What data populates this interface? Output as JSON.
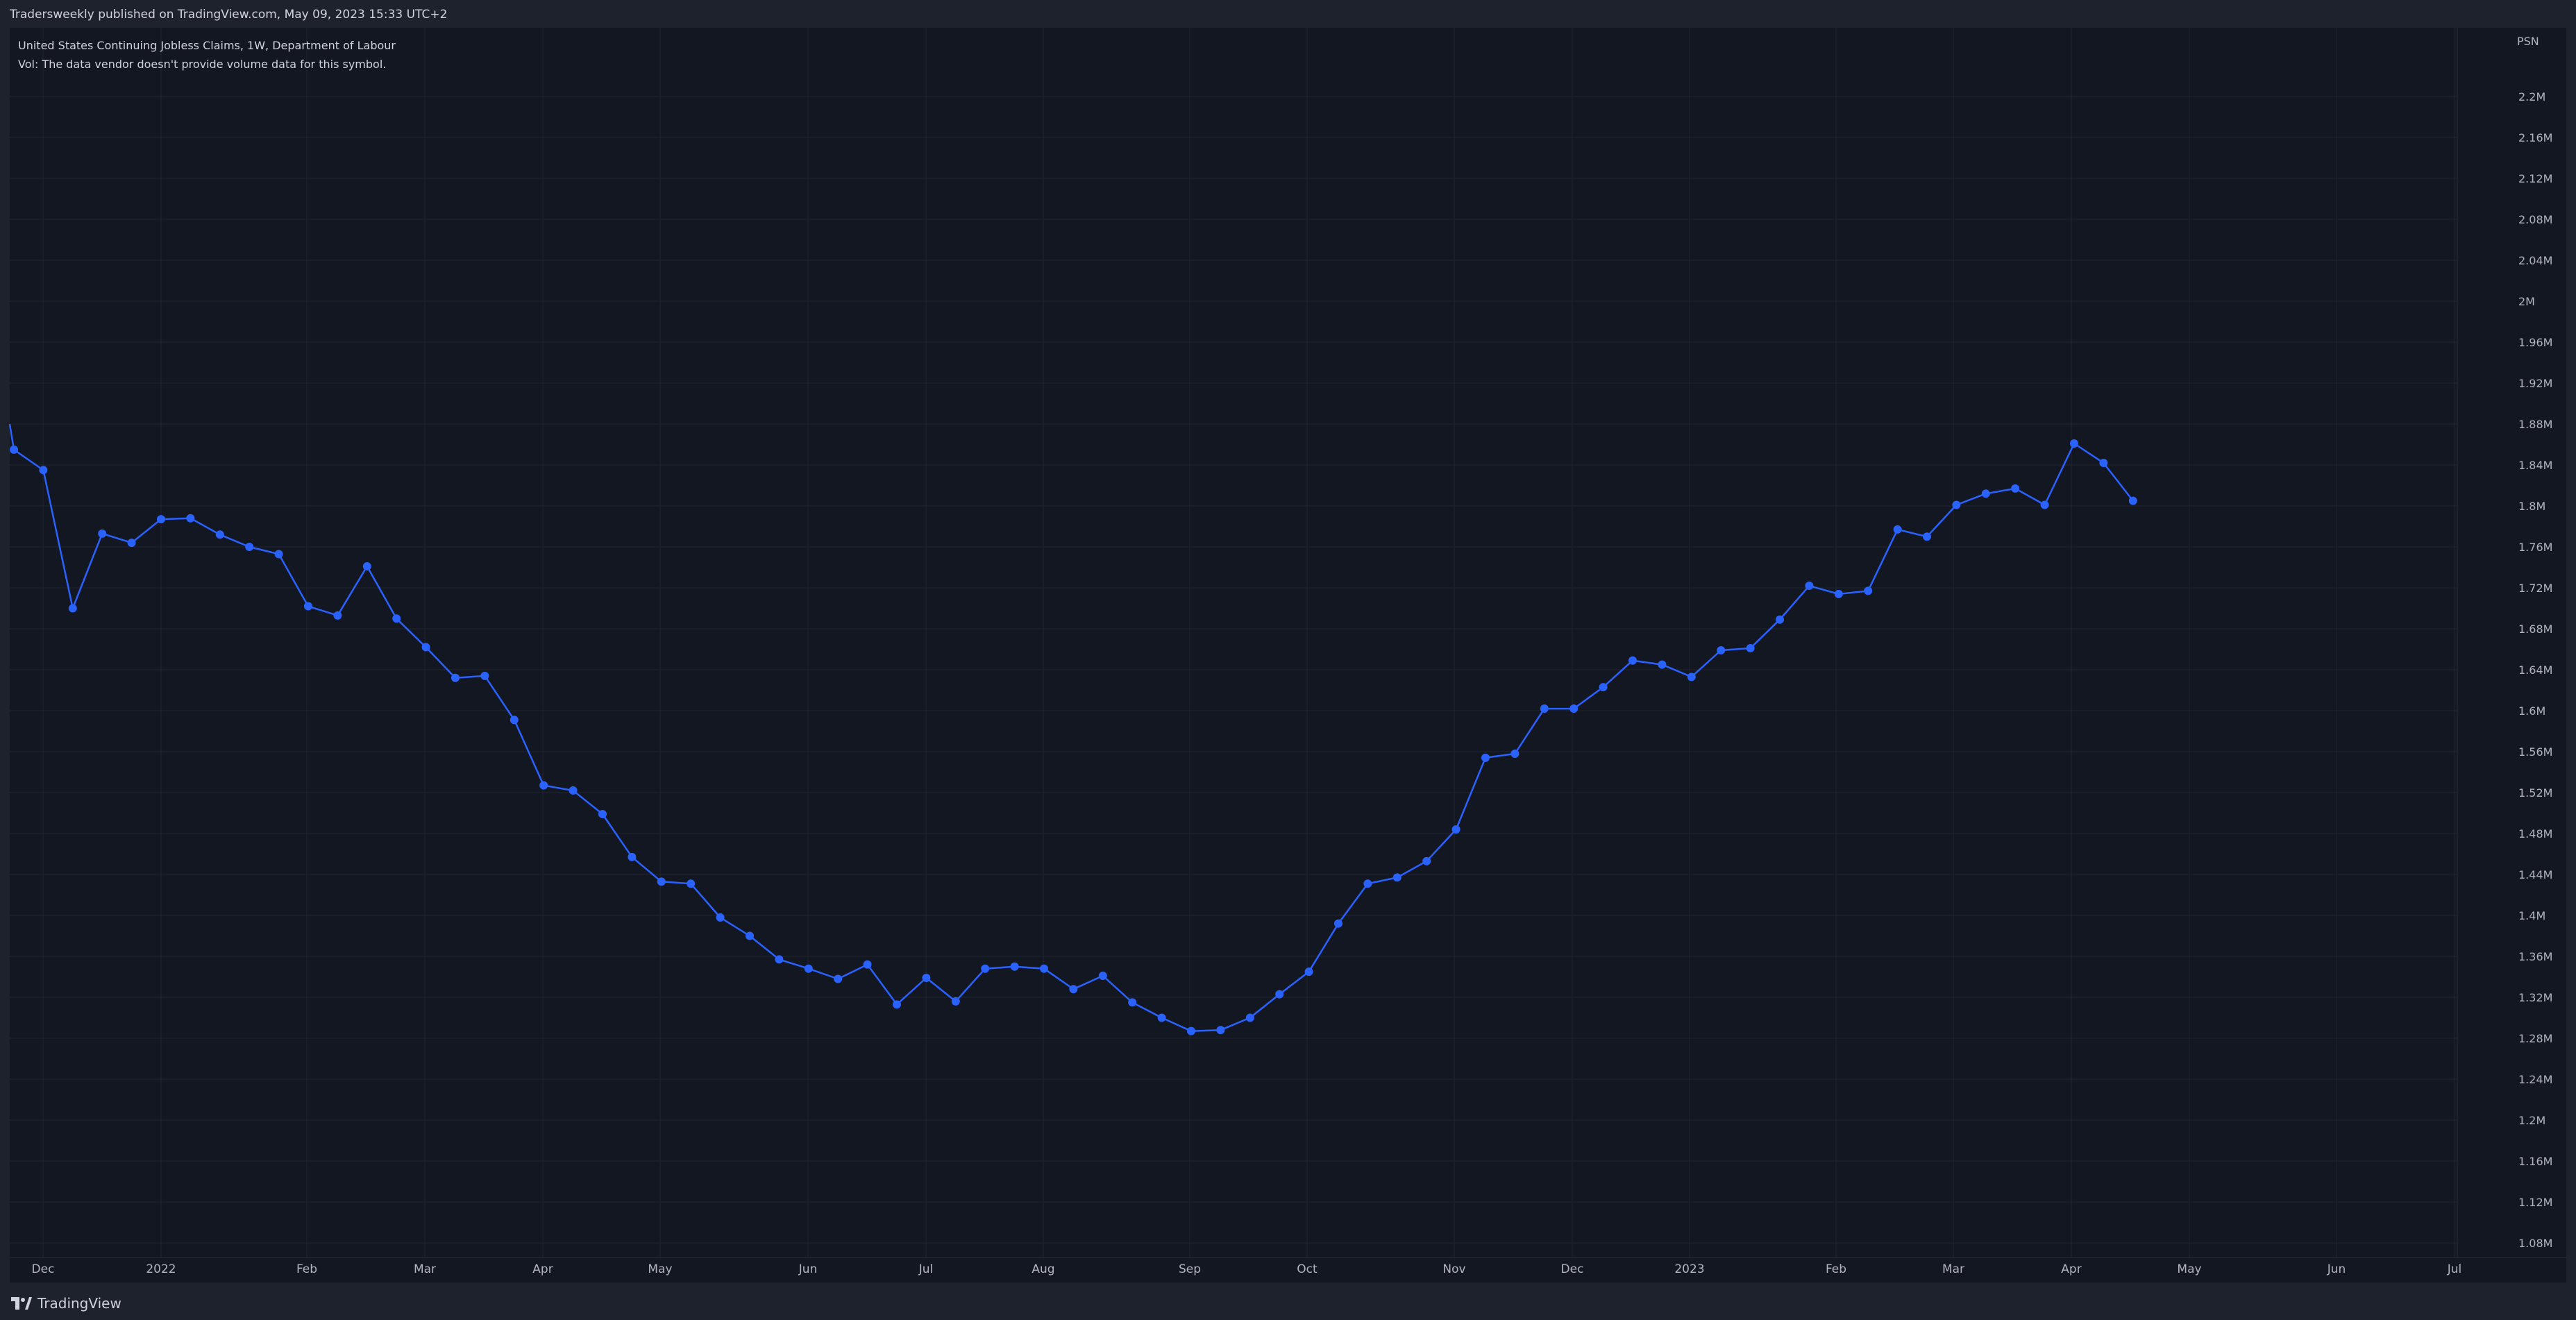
{
  "header": {
    "publish_line": "Tradersweekly published on TradingView.com, May 09, 2023 15:33 UTC+2"
  },
  "legend": {
    "symbol_line": "United States Continuing Jobless Claims, 1W, Department of Labour",
    "volume_line": "Vol: The data vendor doesn't provide volume data for this symbol."
  },
  "price_scale": {
    "currency": "PSN"
  },
  "footer": {
    "brand": "TradingView",
    "logo_icon": "tradingview-logo-icon"
  },
  "colors": {
    "line": "#2962ff",
    "background": "#131722",
    "grid": "#1f2430",
    "text": "#b2b5be"
  },
  "chart_data": {
    "type": "line",
    "title": "United States Continuing Jobless Claims, 1W, Department of Labour",
    "xlabel": "",
    "ylabel": "",
    "grid": true,
    "ylim": [
      1060000,
      2260000
    ],
    "x_tick_labels": [
      "Dec",
      "2022",
      "Feb",
      "Mar",
      "Apr",
      "May",
      "Jun",
      "Jul",
      "Aug",
      "Sep",
      "Oct",
      "Nov",
      "Dec",
      "2023",
      "Feb",
      "Mar",
      "Apr",
      "May",
      "Jun",
      "Jul"
    ],
    "y_tick_labels": [
      "2.2M",
      "2.16M",
      "2.12M",
      "2.08M",
      "2.04M",
      "2M",
      "1.96M",
      "1.92M",
      "1.88M",
      "1.84M",
      "1.8M",
      "1.76M",
      "1.72M",
      "1.68M",
      "1.64M",
      "1.6M",
      "1.56M",
      "1.52M",
      "1.48M",
      "1.44M",
      "1.4M",
      "1.36M",
      "1.32M",
      "1.28M",
      "1.24M",
      "1.2M",
      "1.16M",
      "1.12M",
      "1.08M"
    ],
    "series": [
      {
        "values": [
          1855000,
          1835000,
          1700000,
          1773000,
          1764000,
          1787000,
          1788000,
          1772000,
          1760000,
          1753000,
          1702000,
          1693000,
          1741000,
          1690000,
          1662000,
          1632000,
          1634000,
          1591000,
          1527000,
          1522000,
          1499000,
          1457000,
          1433000,
          1431000,
          1398000,
          1380000,
          1357000,
          1348000,
          1338000,
          1352000,
          1313000,
          1339000,
          1316000,
          1348000,
          1350000,
          1348000,
          1328000,
          1341000,
          1315000,
          1300000,
          1287000,
          1288000,
          1300000,
          1323000,
          1345000,
          1392000,
          1431000,
          1437000,
          1453000,
          1484000,
          1554000,
          1558000,
          1602000,
          1602000,
          1623000,
          1649000,
          1645000,
          1633000,
          1659000,
          1661000,
          1689000,
          1722000,
          1714000,
          1717000,
          1777000,
          1770000,
          1801000,
          1812000,
          1817000,
          1801000,
          1861000,
          1842000,
          1805000
        ]
      }
    ]
  }
}
